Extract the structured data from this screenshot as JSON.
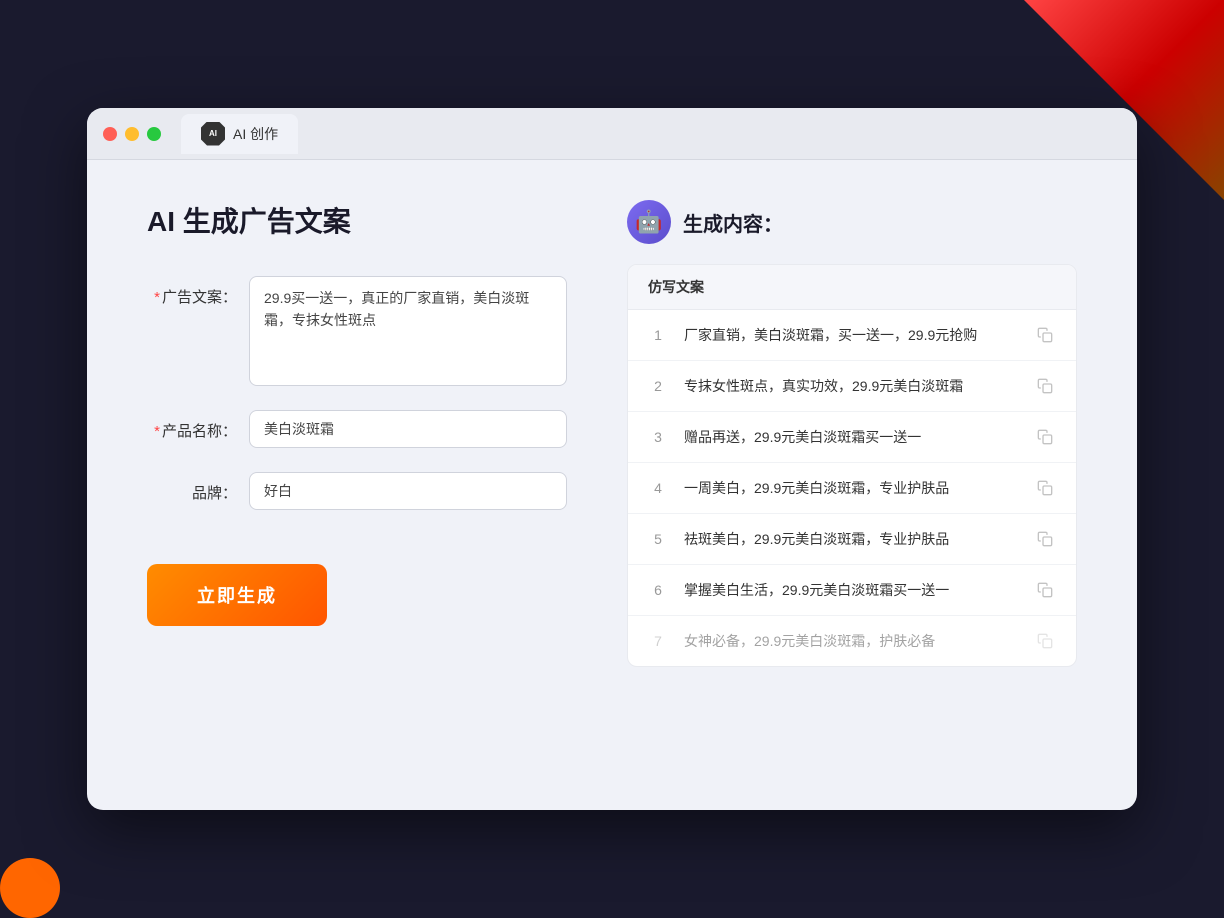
{
  "browser": {
    "tab_title": "AI 创作",
    "traffic_lights": [
      "red",
      "yellow",
      "green"
    ]
  },
  "page": {
    "title": "AI 生成广告文案",
    "form": {
      "ad_copy_label": "广告文案：",
      "ad_copy_required": "*",
      "ad_copy_value": "29.9买一送一，真正的厂家直销，美白淡斑霜，专抹女性斑点",
      "product_name_label": "产品名称：",
      "product_name_required": "*",
      "product_name_value": "美白淡斑霜",
      "brand_label": "品牌：",
      "brand_value": "好白",
      "generate_btn": "立即生成"
    },
    "result": {
      "title": "生成内容：",
      "table_header": "仿写文案",
      "rows": [
        {
          "id": 1,
          "text": "厂家直销，美白淡斑霜，买一送一，29.9元抢购",
          "faded": false
        },
        {
          "id": 2,
          "text": "专抹女性斑点，真实功效，29.9元美白淡斑霜",
          "faded": false
        },
        {
          "id": 3,
          "text": "赠品再送，29.9元美白淡斑霜买一送一",
          "faded": false
        },
        {
          "id": 4,
          "text": "一周美白，29.9元美白淡斑霜，专业护肤品",
          "faded": false
        },
        {
          "id": 5,
          "text": "祛斑美白，29.9元美白淡斑霜，专业护肤品",
          "faded": false
        },
        {
          "id": 6,
          "text": "掌握美白生活，29.9元美白淡斑霜买一送一",
          "faded": false
        },
        {
          "id": 7,
          "text": "女神必备，29.9元美白淡斑霜，护肤必备",
          "faded": true
        }
      ]
    }
  }
}
